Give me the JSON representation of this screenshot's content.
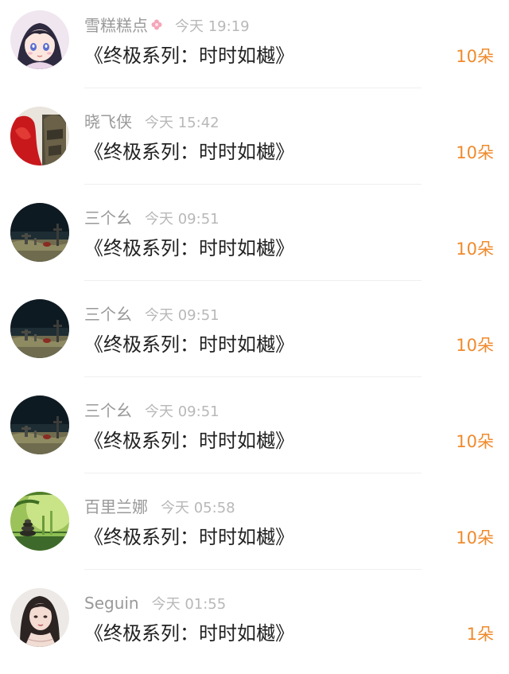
{
  "gift_list": {
    "items": [
      {
        "name": "雪糕糕点",
        "time": "今天 19:19",
        "title": "《终极系列：时时如樾》",
        "gift": "10朵",
        "avatar": "anime-girl-avatar",
        "name_badge": "flower-icon"
      },
      {
        "name": "晓飞侠",
        "time": "今天 15:42",
        "title": "《终极系列：时时如樾》",
        "gift": "10朵",
        "avatar": "red-robe-avatar"
      },
      {
        "name": "三个幺",
        "time": "今天 09:51",
        "title": "《终极系列：时时如樾》",
        "gift": "10朵",
        "avatar": "night-field-avatar"
      },
      {
        "name": "三个幺",
        "time": "今天 09:51",
        "title": "《终极系列：时时如樾》",
        "gift": "10朵",
        "avatar": "night-field-avatar"
      },
      {
        "name": "三个幺",
        "time": "今天 09:51",
        "title": "《终极系列：时时如樾》",
        "gift": "10朵",
        "avatar": "night-field-avatar"
      },
      {
        "name": "百里兰娜",
        "time": "今天 05:58",
        "title": "《终极系列：时时如樾》",
        "gift": "10朵",
        "avatar": "bamboo-stones-avatar"
      },
      {
        "name": "Seguin",
        "time": "今天 01:55",
        "title": "《终极系列：时时如樾》",
        "gift": "1朵",
        "avatar": "portrait-woman-avatar"
      }
    ]
  },
  "colors": {
    "name": "#999999",
    "time": "#b8b8b8",
    "title": "#222222",
    "gift": "#f08a2c",
    "divider": "#efefef"
  }
}
